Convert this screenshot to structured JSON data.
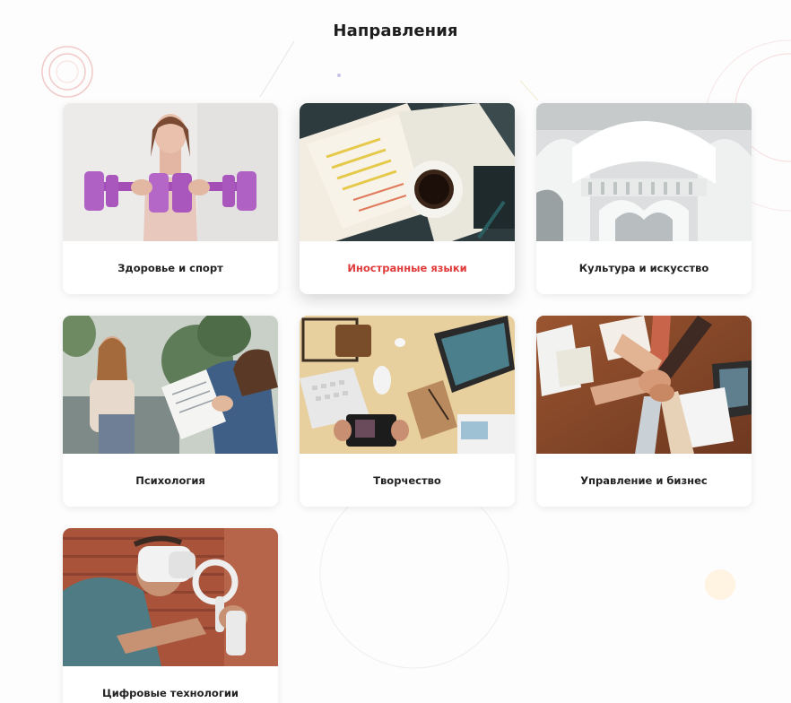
{
  "page": {
    "title": "Направления"
  },
  "colors": {
    "active_label": "#e03b3b",
    "label": "#222222"
  },
  "cards": [
    {
      "label": "Здоровье и спорт",
      "image": "woman-holding-purple-dumbbells",
      "active": false
    },
    {
      "label": "Иностранные языки",
      "image": "textbook-with-coffee-cup",
      "active": true
    },
    {
      "label": "Культура и искусство",
      "image": "ornate-white-arches-interior",
      "active": false
    },
    {
      "label": "Психология",
      "image": "therapist-session-notes",
      "active": false
    },
    {
      "label": "Творчество",
      "image": "creative-desk-flatlay",
      "active": false
    },
    {
      "label": "Управление и бизнес",
      "image": "team-hands-stacked",
      "active": false
    },
    {
      "label": "Цифровые технологии",
      "image": "vr-headset-user",
      "active": false
    }
  ]
}
